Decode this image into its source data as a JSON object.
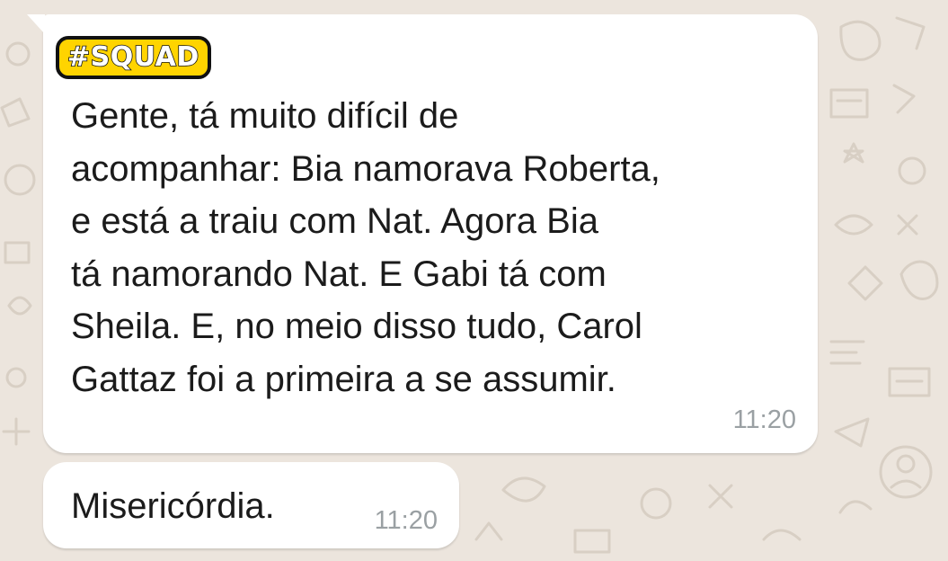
{
  "theme": {
    "background": "#ece5dd",
    "bubble": "#ffffff",
    "text": "#1b1b1b",
    "timestamp": "#9aa0a3",
    "sender_label_bg": "#ffd400"
  },
  "messages": [
    {
      "sender": "#SQUAD",
      "text": "Gente, tá muito difícil de\nacompanhar: Bia namorava Roberta,\ne está a traiu com Nat. Agora Bia\ntá namorando Nat. E Gabi tá com\nSheila. E, no meio disso tudo, Carol\nGattaz foi a primeira a se assumir.",
      "time": "11:20"
    },
    {
      "text": "Misericórdia.",
      "time": "11:20"
    }
  ]
}
